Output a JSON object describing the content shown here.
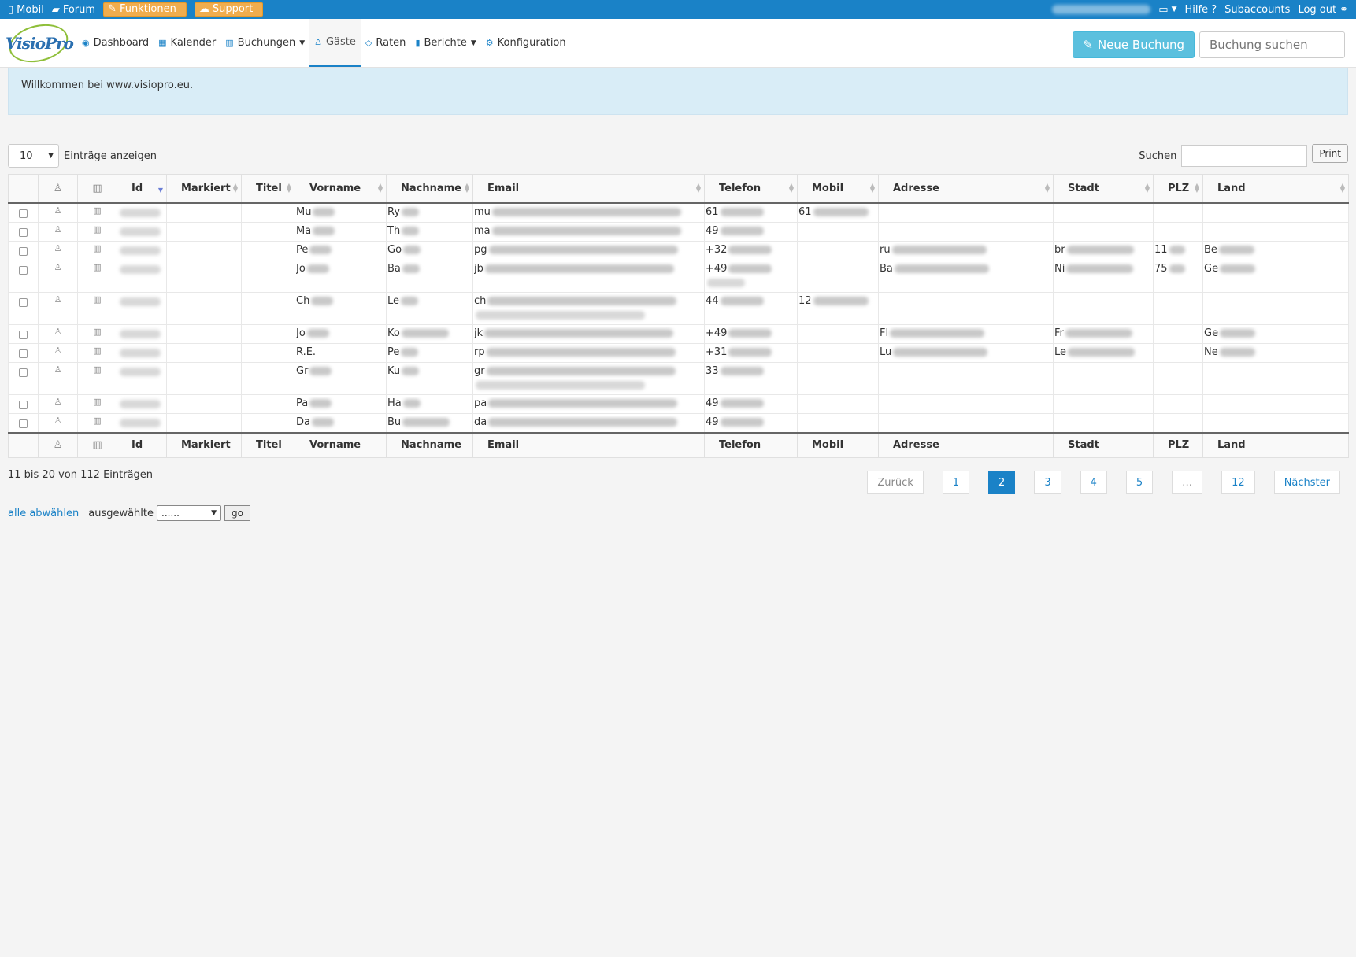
{
  "topbar": {
    "mobile": "Mobil",
    "forum": "Forum",
    "features": "Funktionen",
    "support": "Support",
    "help": "Hilfe ?",
    "subaccounts": "Subaccounts",
    "logout": "Log out"
  },
  "nav": {
    "logo": "VisioPro",
    "items": [
      "Dashboard",
      "Kalender",
      "Buchungen",
      "Gäste",
      "Raten",
      "Berichte",
      "Konfiguration"
    ],
    "new_booking": "Neue Buchung",
    "search_placeholder": "Buchung suchen"
  },
  "alert": "Willkommen bei www.visiopro.eu.",
  "tools": {
    "length_value": "10",
    "length_label": "Einträge anzeigen",
    "filter_label": "Suchen",
    "print": "Print"
  },
  "columns": [
    "Id",
    "Markiert",
    "Titel",
    "Vorname",
    "Nachname",
    "Email",
    "Telefon",
    "Mobil",
    "Adresse",
    "Stadt",
    "PLZ",
    "Land"
  ],
  "rows": [
    {
      "vorname": "Mu",
      "nachname": "Ry",
      "email": "mu",
      "telefon": "61",
      "telefon2": "",
      "mobil": "61",
      "adresse": "",
      "stadt": "",
      "plz": "",
      "land": "",
      "email2": false
    },
    {
      "vorname": "Ma",
      "nachname": "Th",
      "email": "ma",
      "telefon": "49",
      "telefon2": "",
      "mobil": "",
      "adresse": "",
      "stadt": "",
      "plz": "",
      "land": "",
      "email2": false
    },
    {
      "vorname": "Pe",
      "nachname": "Go",
      "email": "pg",
      "telefon": "+32",
      "telefon2": "",
      "mobil": "",
      "adresse": "ru",
      "stadt": "br",
      "plz": "11",
      "land": "Be",
      "email2": false
    },
    {
      "vorname": "Jo",
      "nachname": "Ba",
      "email": "jb",
      "telefon": "+49",
      "telefon2": "x",
      "mobil": "",
      "adresse": "Ba",
      "stadt": "Ni",
      "plz": "75",
      "land": "Ge",
      "email2": false
    },
    {
      "vorname": "Ch",
      "nachname": "Le",
      "email": "ch",
      "telefon": "44",
      "telefon2": "",
      "mobil": "12",
      "adresse": "",
      "stadt": "",
      "plz": "",
      "land": "",
      "email2": true
    },
    {
      "vorname": "Jo",
      "nachname": "Ko",
      "email": "jk",
      "telefon": "+49",
      "telefon2": "",
      "mobil": "",
      "adresse": "Fl",
      "stadt": "Fr",
      "plz": "",
      "land": "Ge",
      "email2": false
    },
    {
      "vorname": "R.E.",
      "nachname": "Pe",
      "email": "rp",
      "telefon": "+31",
      "telefon2": "",
      "mobil": "",
      "adresse": "Lu",
      "stadt": "Le",
      "plz": "",
      "land": "Ne",
      "email2": false
    },
    {
      "vorname": "Gr",
      "nachname": "Ku",
      "email": "gr",
      "telefon": "33",
      "telefon2": "",
      "mobil": "",
      "adresse": "",
      "stadt": "",
      "plz": "",
      "land": "",
      "email2": true
    },
    {
      "vorname": "Pa",
      "nachname": "Ha",
      "email": "pa",
      "telefon": "49",
      "telefon2": "",
      "mobil": "",
      "adresse": "",
      "stadt": "",
      "plz": "",
      "land": "",
      "email2": false
    },
    {
      "vorname": "Da",
      "nachname": "Bu",
      "email": "da",
      "telefon": "49",
      "telefon2": "",
      "mobil": "",
      "adresse": "",
      "stadt": "",
      "plz": "",
      "land": "",
      "email2": false
    }
  ],
  "info": "11 bis 20 von 112 Einträgen",
  "pager": {
    "prev": "Zurück",
    "pages": [
      "1",
      "2",
      "3",
      "4",
      "5",
      "…",
      "12"
    ],
    "active": "2",
    "next": "Nächster"
  },
  "bulk": {
    "deselect_all": "alle abwählen",
    "selected_label": "ausgewählte",
    "select_value": "......",
    "go": "go"
  },
  "colors": {
    "topbar": "#1a82c7",
    "orange": "#f0ad4e",
    "new_booking": "#5bc0de",
    "alert": "#d9edf7"
  }
}
